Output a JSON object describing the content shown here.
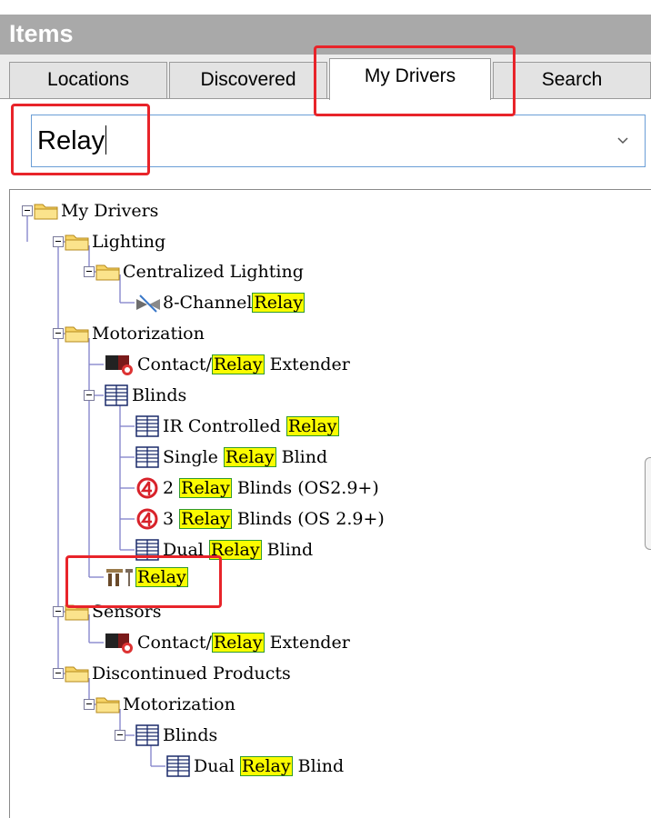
{
  "panel": {
    "title": "Items"
  },
  "tabs": [
    {
      "label": "Locations"
    },
    {
      "label": "Discovered"
    },
    {
      "label": "My Drivers"
    },
    {
      "label": "Search"
    }
  ],
  "search": {
    "value": "Relay"
  },
  "tree": {
    "root": "My Drivers",
    "lighting": "Lighting",
    "centralized_lighting": "Centralized Lighting",
    "eight_channel": {
      "prefix": "8-Channel ",
      "match": "Relay",
      "suffix": ""
    },
    "motorization": "Motorization",
    "contact_relay_1": {
      "prefix": "Contact/",
      "match": "Relay",
      "suffix": " Extender"
    },
    "blinds": "Blinds",
    "ir_controlled": {
      "prefix": "IR Controlled ",
      "match": "Relay",
      "suffix": ""
    },
    "single_relay": {
      "prefix": "Single ",
      "match": "Relay",
      "suffix": " Blind"
    },
    "two_relay": {
      "prefix": "2 ",
      "match": "Relay",
      "suffix": " Blinds (OS2.9+)"
    },
    "three_relay": {
      "prefix": "3 ",
      "match": "Relay",
      "suffix": " Blinds (OS 2.9+)"
    },
    "dual_relay_1": {
      "prefix": "Dual ",
      "match": "Relay",
      "suffix": " Blind"
    },
    "relay": {
      "prefix": "",
      "match": "Relay",
      "suffix": ""
    },
    "sensors": "Sensors",
    "contact_relay_2": {
      "prefix": "Contact/",
      "match": "Relay",
      "suffix": " Extender"
    },
    "discontinued": "Discontinued Products",
    "disc_motorization": "Motorization",
    "disc_blinds": "Blinds",
    "dual_relay_2": {
      "prefix": "Dual ",
      "match": "Relay",
      "suffix": " Blind"
    }
  },
  "colors": {
    "highlight": "#fbfb00",
    "annotation": "#e8242a",
    "header": "#a9a9a9"
  }
}
